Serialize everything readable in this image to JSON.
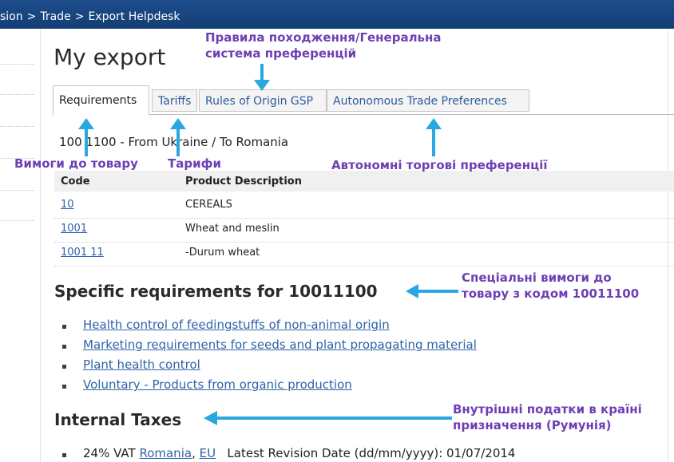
{
  "breadcrumb": {
    "items": [
      "sion",
      "Trade",
      "Export Helpdesk"
    ],
    "separator": ">"
  },
  "page": {
    "title": "My export"
  },
  "tabs": [
    "Requirements",
    "Tariffs",
    "Rules of Origin GSP",
    "Autonomous Trade Preferences"
  ],
  "product": {
    "line": "100 1100 - From Ukraine / To Romania"
  },
  "code_table": {
    "headers": [
      "Code",
      "Product Description"
    ],
    "rows": [
      {
        "code": "10",
        "desc": "CEREALS"
      },
      {
        "code": "1001",
        "desc": "Wheat and meslin"
      },
      {
        "code": "1001 11",
        "desc": "-Durum wheat"
      }
    ]
  },
  "specific": {
    "heading": "Specific requirements for 10011100",
    "items": [
      "Health control of feedingstuffs of non-animal origin",
      "Marketing requirements for seeds and plant propagating material",
      "Plant health control",
      "Voluntary - Products from organic production"
    ]
  },
  "taxes": {
    "heading": "Internal Taxes",
    "vat_prefix": "24% VAT",
    "link_country": "Romania",
    "comma": ",",
    "link_eu": "EU",
    "revision": "Latest Revision Date (dd/mm/yyyy): 01/07/2014"
  },
  "annotations": {
    "rules_line1": "Правила походження/Генеральна",
    "rules_line2": "система преференцій",
    "requirements": "Вимоги до товару",
    "tariffs": "Тарифи",
    "autonomous": "Автономні торгові преференції",
    "specific_line1": "Спеціальні вимоги до",
    "specific_line2": "товару з кодом 10011100",
    "taxes_line1": "Внутрішні податки в країні",
    "taxes_line2": "призначення (Румунія)"
  },
  "colors": {
    "annotation": "#6c3fb4",
    "arrow": "#29a8e0",
    "link": "#2d63a8",
    "topbar": "#1c4d8c"
  }
}
